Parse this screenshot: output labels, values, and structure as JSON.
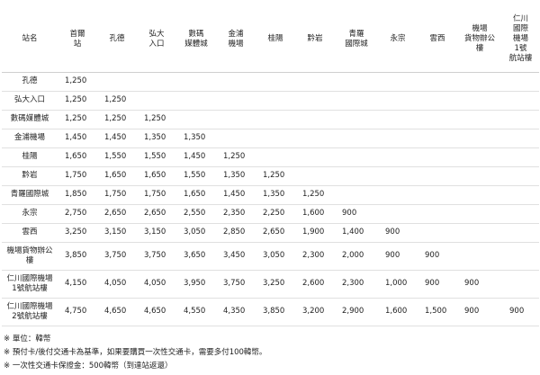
{
  "table": {
    "header": [
      "站名",
      "首爾\n站",
      "孔德",
      "弘大\n入口",
      "數碼\n媒體城",
      "金浦\n機場",
      "桂陽",
      "黔岩",
      "青羅\n國際城",
      "永宗",
      "雲西",
      "機場\n貨物辦公\n樓",
      "仁川\n國際\n機場\n1號\n航站樓"
    ],
    "rows": [
      {
        "station": "孔德",
        "fares": [
          "1,250"
        ]
      },
      {
        "station": "弘大入口",
        "fares": [
          "1,250",
          "1,250"
        ]
      },
      {
        "station": "數碼媒體城",
        "fares": [
          "1,250",
          "1,250",
          "1,250"
        ]
      },
      {
        "station": "金浦機場",
        "fares": [
          "1,450",
          "1,450",
          "1,350",
          "1,350"
        ]
      },
      {
        "station": "桂陽",
        "fares": [
          "1,650",
          "1,550",
          "1,550",
          "1,450",
          "1,250"
        ]
      },
      {
        "station": "黔岩",
        "fares": [
          "1,750",
          "1,650",
          "1,650",
          "1,550",
          "1,350",
          "1,250"
        ]
      },
      {
        "station": "青羅國際城",
        "fares": [
          "1,850",
          "1,750",
          "1,750",
          "1,650",
          "1,450",
          "1,350",
          "1,250"
        ]
      },
      {
        "station": "永宗",
        "fares": [
          "2,750",
          "2,650",
          "2,650",
          "2,550",
          "2,350",
          "2,250",
          "1,600",
          "900"
        ]
      },
      {
        "station": "雲西",
        "fares": [
          "3,250",
          "3,150",
          "3,150",
          "3,050",
          "2,850",
          "2,650",
          "1,900",
          "1,400",
          "900"
        ]
      },
      {
        "station": "機場貨物辦公\n樓",
        "fares": [
          "3,850",
          "3,750",
          "3,750",
          "3,650",
          "3,450",
          "3,050",
          "2,300",
          "2,000",
          "900",
          "900"
        ],
        "tall": true
      },
      {
        "station": "仁川國際機場\n1號航站樓",
        "fares": [
          "4,150",
          "4,050",
          "4,050",
          "3,950",
          "3,750",
          "3,250",
          "2,600",
          "2,300",
          "1,000",
          "900",
          "900"
        ],
        "tall": true
      },
      {
        "station": "仁川國際機場\n2號航站樓",
        "fares": [
          "4,750",
          "4,650",
          "4,650",
          "4,550",
          "4,350",
          "3,850",
          "3,200",
          "2,900",
          "1,600",
          "1,500",
          "900",
          "900"
        ],
        "tall": true
      }
    ]
  },
  "notes": [
    "※ 單位：韓幣",
    "※ 預付卡/後付交通卡為基準，如果要購買一次性交通卡，需要多付100韓幣。",
    "※ 一次性交通卡保證金：500韓幣（到達站返還）"
  ]
}
